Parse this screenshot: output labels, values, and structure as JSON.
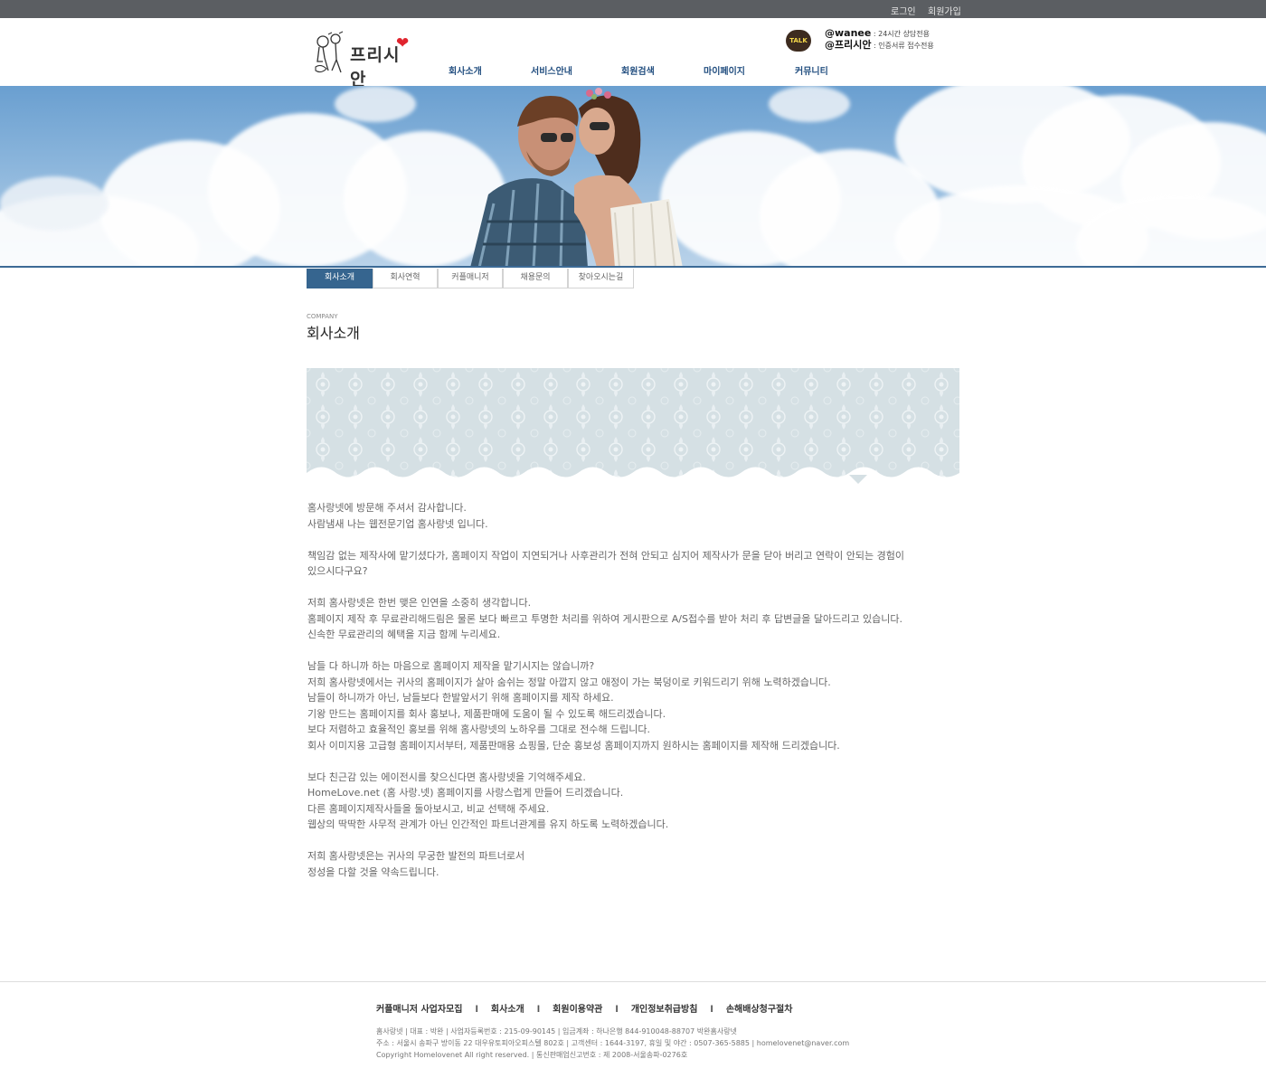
{
  "top_links": {
    "login": "로그인",
    "join": "회원가입"
  },
  "header": {
    "logo_text": "프리시안",
    "talk_badge": "TALK",
    "kakao1_id": "@wanee",
    "kakao1_desc": " : 24시간 상담전용",
    "kakao2_id": "@프리시안",
    "kakao2_desc": " : 인증서류 접수전용",
    "nav": [
      "회사소개",
      "서비스안내",
      "회원검색",
      "마이페이지",
      "커뮤니티"
    ]
  },
  "subtabs": [
    "회사소개",
    "회사연혁",
    "커플매니저",
    "채용문의",
    "찾아오시는길"
  ],
  "page_title": {
    "en": "COMPANY",
    "ko": "회사소개"
  },
  "body_paragraphs": [
    [
      "홈사랑넷에 방문해 주셔서 감사합니다.",
      "사람냄새 나는 웹전문기업 홈사랑넷 입니다."
    ],
    [
      "책임감 없는 제작사에 맡기셨다가, 홈페이지 작업이 지연되거나 사후관리가 전혀 안되고 심지어 제작사가 문을 닫아 버리고 연락이 안되는 경험이",
      "있으시다구요?"
    ],
    [
      "저희 홈사랑넷은 한번 맺은 인연을 소중히 생각합니다.",
      "홈페이지 제작 후 무료관리해드림은 물론 보다 빠르고 투명한 처리를 위하여 게시판으로 A/S접수를 받아 처리 후 답변글을 달아드리고 있습니다.",
      "신속한 무료관리의 혜택을 지금 함께 누리세요."
    ],
    [
      "남들 다 하니까 하는 마음으로 홈페이지 제작을 맡기시지는 않습니까?",
      "저희 홈사랑넷에서는 귀사의 홈페이지가 살아 숨쉬는 정말 아깝지 않고 애정이 가는 북덩이로 키워드리기 위해 노력하겠습니다.",
      "남들이 하니까가 아닌, 남들보다 한발앞서기 위해 홈페이지를 제작 하세요.",
      "기왕 만드는 홈페이지를 회사 홍보나, 제품판매에 도움이 될 수 있도록 해드리겠습니다.",
      "보다 저렴하고 효율적인 홍보를 위해 홈사랑넷의 노하우를 그대로 전수해 드립니다.",
      "회사 이미지용 고급형 홈페이지서부터, 제품판매용 쇼핑몰, 단순 홍보성 홈페이지까지 원하시는 홈페이지를 제작해 드리겠습니다."
    ],
    [
      "보다 친근감 있는 에이전시를 찾으신다면 홈사랑넷을 기억해주세요.",
      "HomeLove.net (홈 사랑.넷) 홈페이지를 사랑스럽게 만들어 드리겠습니다.",
      "다른 홈페이지제작사들을 둘아보시고, 비교 선택해 주세요.",
      "웹상의 딱딱한 사무적 관계가 아닌 인간적인 파트너관계를 유지 하도록 노력하겠습니다."
    ],
    [
      "저희 홈사랑넷은는 귀사의 무궁한 발전의 파트너로서",
      "정성을 다할 것을 약속드립니다."
    ]
  ],
  "footer": {
    "links": [
      "커플매니저 사업자모집",
      "회사소개",
      "회원이용약관",
      "개인정보취급방침",
      "손해배상청구절차"
    ],
    "separator": "l",
    "info_line1": "홈사랑넷  |  대표 : 박완  |  사업자등록번호 : 215-09-90145  |  입금계좌 : 하나은행 844-910048-88707 박완홈사랑넷",
    "info_line2": "주소 : 서울시 송파구 방이동 22 대우유토피아오피스텔 802호  |  고객센터 : 1644-3197, 휴일 및 야간 : 0507-365-5885  |  homelovenet@naver.com",
    "info_line3": "Copyright Homelovenet All right reserved.   |   통신판매업신고번호 : 제 2008-서울송파-0276호"
  },
  "colors": {
    "topbar": "#5b5e62",
    "nav_text": "#234f80",
    "tab_active": "#36658f",
    "lace": "#d5e0e4"
  },
  "icons": [
    "kakao-talk-icon",
    "logo-illustration",
    "heart-icon"
  ]
}
